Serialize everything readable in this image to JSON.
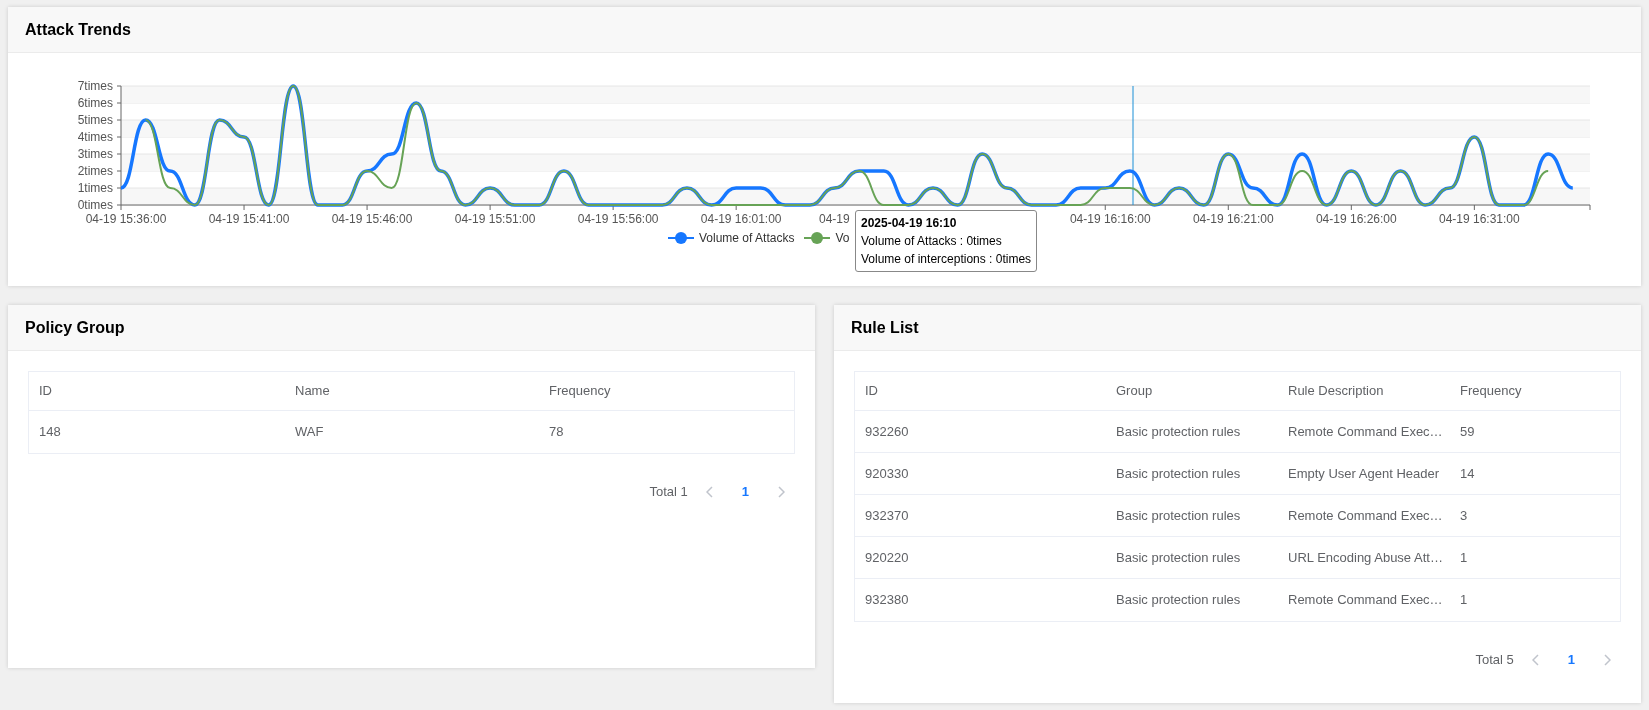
{
  "trend_card": {
    "title": "Attack Trends",
    "chart_data": {
      "type": "line",
      "grid": true,
      "categories": [
        "04-19 15:36:00",
        null,
        null,
        null,
        null,
        "04-19 15:41:00",
        null,
        null,
        null,
        null,
        "04-19 15:46:00",
        null,
        null,
        null,
        null,
        "04-19 15:51:00",
        null,
        null,
        null,
        null,
        "04-19 15:56:00",
        null,
        null,
        null,
        null,
        "04-19 16:01:00",
        null,
        null,
        null,
        null,
        null,
        null,
        null,
        null,
        null,
        null,
        null,
        null,
        null,
        null,
        "04-19 16:16:00",
        null,
        null,
        null,
        null,
        "04-19 16:21:00",
        null,
        null,
        null,
        null,
        "04-19 16:26:00",
        null,
        null,
        null,
        null,
        "04-19 16:31:00",
        null,
        null,
        null,
        null
      ],
      "series": [
        {
          "name": "Volume of Attacks",
          "color": "#1677ff",
          "values": [
            1,
            5,
            2,
            0,
            5,
            4,
            0,
            7,
            0,
            0,
            2,
            3,
            6,
            2,
            0,
            1,
            0,
            0,
            2,
            0,
            0,
            0,
            0,
            1,
            0,
            1,
            1,
            0,
            0,
            1,
            2,
            2,
            0,
            1,
            0,
            3,
            1,
            0,
            0,
            1,
            1,
            2,
            0,
            1,
            0,
            3,
            1,
            0,
            3,
            0,
            2,
            0,
            2,
            0,
            1,
            4,
            0,
            0,
            3,
            1
          ]
        },
        {
          "name": "Volume of interceptions",
          "color": "#67a356",
          "values": [
            null,
            5,
            1,
            0,
            5,
            4,
            0,
            7,
            0,
            0,
            2,
            1,
            6,
            2,
            0,
            1,
            0,
            0,
            2,
            0,
            0,
            0,
            0,
            1,
            0,
            0,
            0,
            0,
            0,
            1,
            2,
            0,
            0,
            1,
            0,
            3,
            1,
            0,
            0,
            0,
            1,
            1,
            0,
            1,
            0,
            3,
            0,
            0,
            2,
            0,
            2,
            0,
            2,
            0,
            1,
            4,
            0,
            0,
            2,
            null
          ]
        }
      ],
      "ylim": [
        0,
        7
      ],
      "yticks": [
        {
          "value": 0,
          "label": "0times"
        },
        {
          "value": 1,
          "label": "1times"
        },
        {
          "value": 2,
          "label": "2times"
        },
        {
          "value": 3,
          "label": "3times"
        },
        {
          "value": 4,
          "label": "4times"
        },
        {
          "value": 5,
          "label": "5times"
        },
        {
          "value": 6,
          "label": "6times"
        },
        {
          "value": 7,
          "label": "7times"
        }
      ]
    },
    "covered_tick_label": "04-19",
    "legend": [
      {
        "label": "Volume of Attacks",
        "color": "#1677ff"
      },
      {
        "label": "Vo",
        "color": "#67a356"
      }
    ],
    "tooltip": {
      "title": "2025-04-19 16:10",
      "separator": " : ",
      "values": [
        "0times",
        "0times"
      ]
    }
  },
  "policy_card": {
    "title": "Policy Group",
    "columns": [
      "ID",
      "Name",
      "Frequency"
    ],
    "rows": [
      [
        "148",
        "WAF",
        "78"
      ]
    ],
    "pagination": {
      "total": "Total 1",
      "pages": [
        {
          "label": "1",
          "selected": true
        }
      ]
    }
  },
  "rule_card": {
    "title": "Rule List",
    "columns": [
      "ID",
      "Group",
      "Rule Description",
      "Frequency"
    ],
    "rows": [
      [
        "932260",
        "Basic protection rules",
        "Remote Command Exec…",
        "59"
      ],
      [
        "920330",
        "Basic protection rules",
        "Empty User Agent Header",
        "14"
      ],
      [
        "932370",
        "Basic protection rules",
        "Remote Command Exec…",
        "3"
      ],
      [
        "920220",
        "Basic protection rules",
        "URL Encoding Abuse Att…",
        "1"
      ],
      [
        "932380",
        "Basic protection rules",
        "Remote Command Exec…",
        "1"
      ]
    ],
    "pagination": {
      "total": "Total 5",
      "pages": [
        {
          "label": "1",
          "selected": true
        }
      ]
    }
  }
}
